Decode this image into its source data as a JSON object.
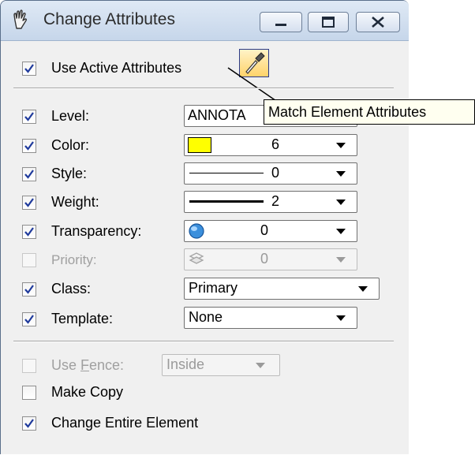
{
  "window": {
    "title": "Change Attributes"
  },
  "top": {
    "use_active": {
      "label": "Use Active Attributes",
      "checked": true
    }
  },
  "attributes": {
    "level": {
      "label": "Level:",
      "checked": true,
      "value": "ANNOTA"
    },
    "color": {
      "label": "Color:",
      "checked": true,
      "value": "6",
      "swatch": "#ffff00"
    },
    "style": {
      "label": "Style:",
      "checked": true,
      "value": "0"
    },
    "weight": {
      "label": "Weight:",
      "checked": true,
      "value": "2"
    },
    "transparency": {
      "label": "Transparency:",
      "checked": true,
      "value": "0"
    },
    "priority": {
      "label": "Priority:",
      "checked": false,
      "value": "0",
      "disabled": true
    },
    "class": {
      "label": "Class:",
      "checked": true,
      "value": "Primary"
    },
    "template": {
      "label": "Template:",
      "checked": true,
      "value": "None"
    }
  },
  "bottom": {
    "use_fence": {
      "label_pre": "Use ",
      "label_accel": "F",
      "label_post": "ence:",
      "checked": false,
      "disabled": true,
      "value": "Inside"
    },
    "make_copy": {
      "label": "Make Copy",
      "checked": false
    },
    "change_entire": {
      "label": "Change Entire Element",
      "checked": true
    }
  },
  "tooltip": {
    "text": "Match Element Attributes"
  }
}
